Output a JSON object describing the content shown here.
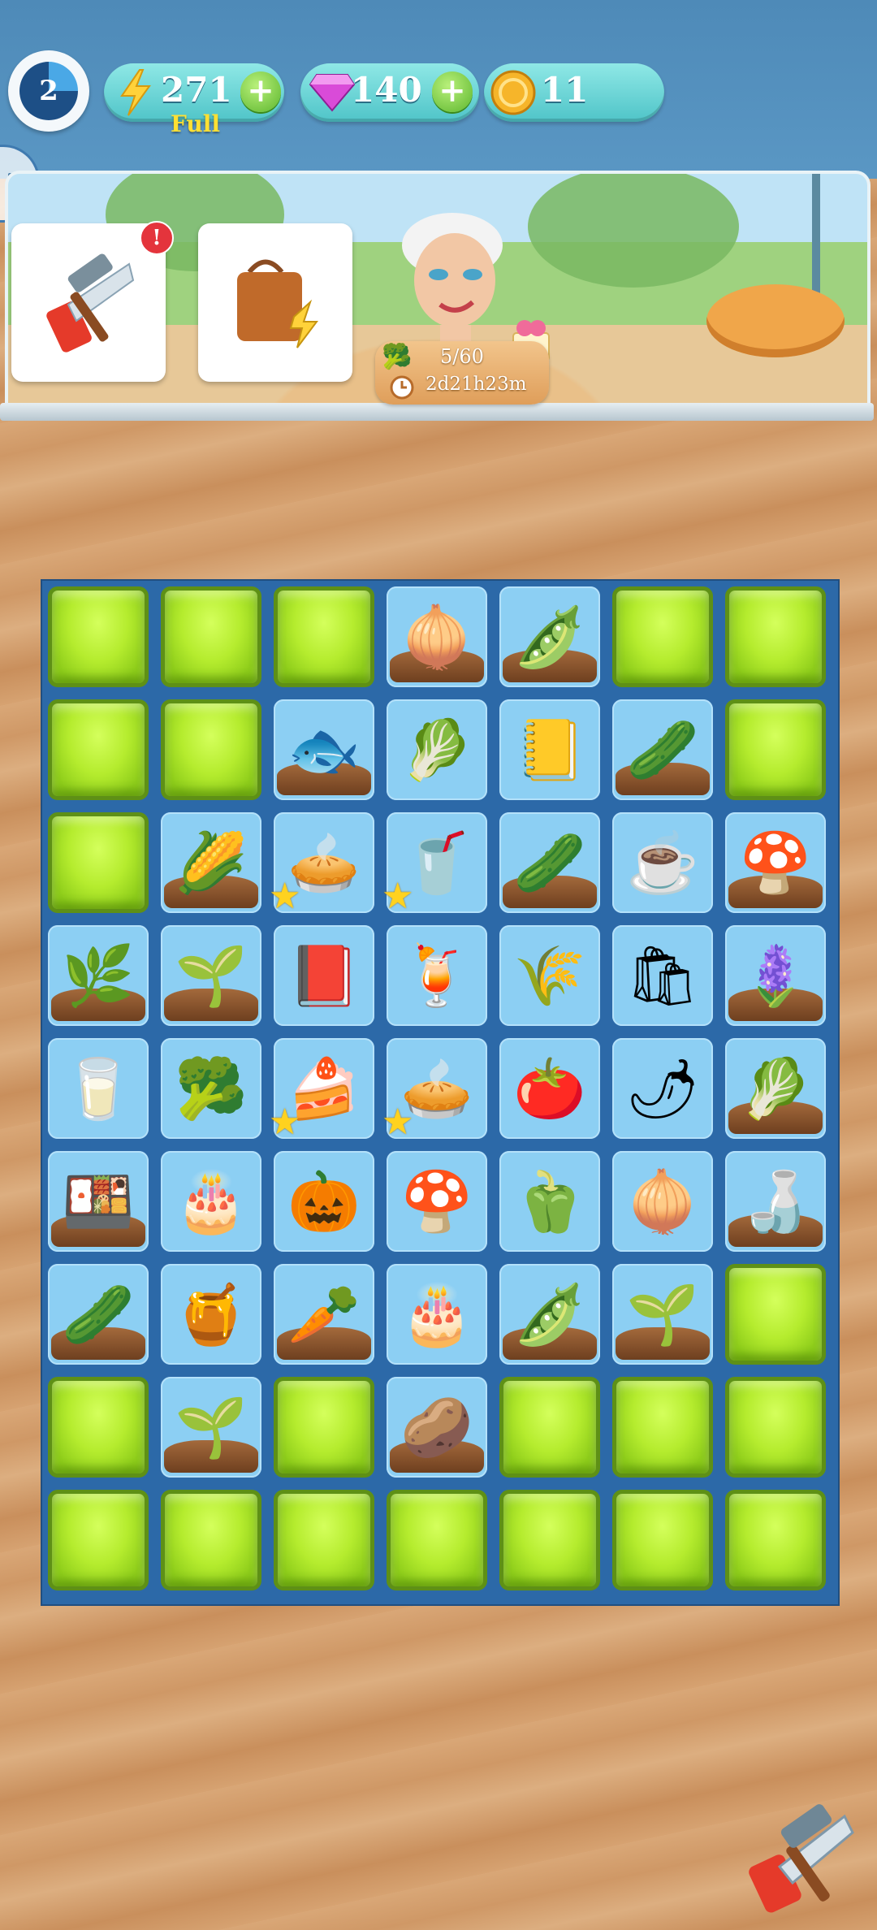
{
  "hud": {
    "level": "2",
    "energy": "271",
    "energy_status": "Full",
    "gems": "140",
    "coins": "11"
  },
  "quest": {
    "progress": "5/60",
    "timer": "2d21h23m"
  },
  "icons": {
    "energy": "lightning-bolt-icon",
    "gem": "purple-gem-icon",
    "coin": "gold-coin-icon",
    "plus": "plus-icon",
    "pause": "pause-icon",
    "tools": "hammer-saw-icon",
    "bag": "shopping-bag-icon",
    "clock": "clock-icon",
    "gift": "gift-box-icon"
  },
  "colors": {
    "board": "#2c69a8",
    "empty_tile": "#b5ec2e",
    "item_tile": "#8ccff3",
    "hud_pill": "#63d2d4",
    "energy_status": "#ffe033",
    "alert": "#e4343c"
  },
  "board": {
    "rows": 9,
    "cols": 7,
    "cells": [
      {
        "t": "empty"
      },
      {
        "t": "empty"
      },
      {
        "t": "empty"
      },
      {
        "t": "item",
        "name": "onion",
        "g": "🧅",
        "dirt": true
      },
      {
        "t": "item",
        "name": "peas",
        "g": "🫛",
        "dirt": true
      },
      {
        "t": "empty"
      },
      {
        "t": "empty"
      },
      {
        "t": "empty"
      },
      {
        "t": "empty"
      },
      {
        "t": "item",
        "name": "fish",
        "g": "🐟",
        "dirt": true
      },
      {
        "t": "item",
        "name": "lettuce",
        "g": "🥬"
      },
      {
        "t": "item",
        "name": "recipe-cards",
        "g": "📒"
      },
      {
        "t": "item",
        "name": "cucumber-sprout",
        "g": "🥒",
        "dirt": true
      },
      {
        "t": "empty"
      },
      {
        "t": "empty"
      },
      {
        "t": "item",
        "name": "corn",
        "g": "🌽",
        "dirt": true
      },
      {
        "t": "item",
        "name": "pie",
        "g": "🥧",
        "star": true
      },
      {
        "t": "item",
        "name": "smoothie",
        "g": "🥤",
        "star": true
      },
      {
        "t": "item",
        "name": "cucumber",
        "g": "🥒",
        "dirt": true
      },
      {
        "t": "item",
        "name": "tea-cup",
        "g": "☕"
      },
      {
        "t": "item",
        "name": "mushroom-large",
        "g": "🍄",
        "dirt": true
      },
      {
        "t": "item",
        "name": "herbs",
        "g": "🌿",
        "dirt": true
      },
      {
        "t": "item",
        "name": "green-onion",
        "g": "🌱",
        "dirt": true
      },
      {
        "t": "item",
        "name": "cookbook",
        "g": "📕"
      },
      {
        "t": "item",
        "name": "juice",
        "g": "🍹"
      },
      {
        "t": "item",
        "name": "flour-bag",
        "g": "🌾"
      },
      {
        "t": "item",
        "name": "shopping-bag",
        "g": "🛍"
      },
      {
        "t": "item",
        "name": "violet-flower",
        "g": "🪻",
        "dirt": true
      },
      {
        "t": "item",
        "name": "coffee-cup",
        "g": "🥛"
      },
      {
        "t": "item",
        "name": "broccoli",
        "g": "🥦"
      },
      {
        "t": "item",
        "name": "fig-cake",
        "g": "🍰",
        "star": true
      },
      {
        "t": "item",
        "name": "cream-pie",
        "g": "🥧",
        "star": true
      },
      {
        "t": "item",
        "name": "tomato",
        "g": "🍅"
      },
      {
        "t": "item",
        "name": "chili-plant",
        "g": "🌶",
        "dirt": false
      },
      {
        "t": "item",
        "name": "cauliflower",
        "g": "🥬",
        "dirt": true
      },
      {
        "t": "item",
        "name": "baking-tray",
        "g": "🍱",
        "dirt": true
      },
      {
        "t": "item",
        "name": "layer-cake",
        "g": "🎂"
      },
      {
        "t": "item",
        "name": "pumpkin",
        "g": "🎃"
      },
      {
        "t": "item",
        "name": "mushroom",
        "g": "🍄"
      },
      {
        "t": "item",
        "name": "pepper",
        "g": "🫑"
      },
      {
        "t": "item",
        "name": "red-onion",
        "g": "🧅"
      },
      {
        "t": "item",
        "name": "milk-jug",
        "g": "🍶",
        "dirt": true
      },
      {
        "t": "item",
        "name": "pickle",
        "g": "🥒",
        "dirt": true
      },
      {
        "t": "item",
        "name": "honey-jar",
        "g": "🍯"
      },
      {
        "t": "item",
        "name": "parsnip",
        "g": "🥕",
        "dirt": true
      },
      {
        "t": "item",
        "name": "birthday-cake",
        "g": "🎂"
      },
      {
        "t": "item",
        "name": "pea-pods",
        "g": "🫛",
        "dirt": true
      },
      {
        "t": "item",
        "name": "leek",
        "g": "🌱",
        "dirt": true
      },
      {
        "t": "empty"
      },
      {
        "t": "empty"
      },
      {
        "t": "item",
        "name": "leek-sprout",
        "g": "🌱",
        "dirt": true
      },
      {
        "t": "empty"
      },
      {
        "t": "item",
        "name": "potato",
        "g": "🥔",
        "dirt": true
      },
      {
        "t": "empty"
      },
      {
        "t": "empty"
      },
      {
        "t": "empty"
      },
      {
        "t": "empty"
      },
      {
        "t": "empty"
      },
      {
        "t": "empty"
      },
      {
        "t": "empty"
      },
      {
        "t": "empty"
      },
      {
        "t": "empty"
      },
      {
        "t": "empty"
      }
    ]
  }
}
